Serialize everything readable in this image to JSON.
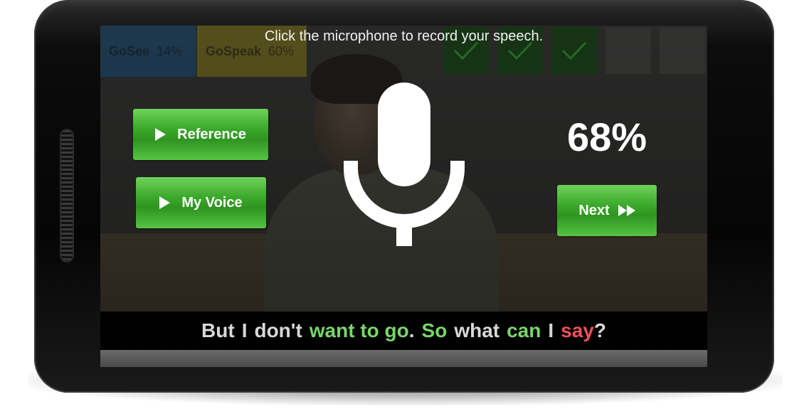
{
  "scores": {
    "gosee": {
      "label": "GoSee",
      "value": "14%"
    },
    "gospeak": {
      "label": "GoSpeak",
      "value": "60%"
    }
  },
  "progress_boxes": [
    {
      "state": "done"
    },
    {
      "state": "done"
    },
    {
      "state": "done"
    },
    {
      "state": "empty"
    },
    {
      "state": "empty"
    }
  ],
  "instruction": "Click the microphone to record your speech.",
  "buttons": {
    "reference": "Reference",
    "my_voice": "My Voice",
    "next": "Next"
  },
  "score_percent": "68%",
  "sentence": [
    {
      "text": "But",
      "color": "neutral"
    },
    {
      "text": "I",
      "color": "neutral"
    },
    {
      "text": "don't",
      "color": "neutral"
    },
    {
      "text": "want to go",
      "color": "good"
    },
    {
      "text": ".",
      "color": "neutral"
    },
    {
      "text": "So",
      "color": "good"
    },
    {
      "text": "what",
      "color": "neutral"
    },
    {
      "text": "can",
      "color": "good"
    },
    {
      "text": "I",
      "color": "neutral"
    },
    {
      "text": "say",
      "color": "bad"
    },
    {
      "text": "?",
      "color": "neutral"
    }
  ],
  "colors": {
    "good": "#78d66a",
    "bad": "#f0505a",
    "neutral": "#d8d8d8",
    "button_green": "#3aa82a"
  }
}
